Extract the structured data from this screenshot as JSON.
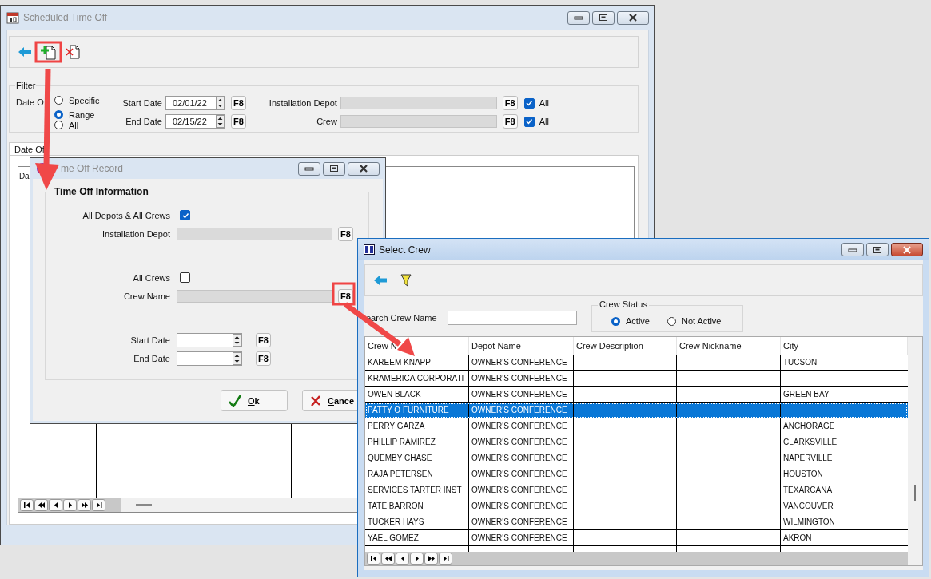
{
  "main_window": {
    "title": "Scheduled Time Off",
    "active": false,
    "filter": {
      "legend": "Filter",
      "date_label": "Date O",
      "radios": [
        {
          "label": "Specific",
          "selected": false
        },
        {
          "label": "Range",
          "selected": true
        },
        {
          "label": "All",
          "selected": false
        }
      ],
      "dates": [
        {
          "label": "Start Date",
          "value": "02/01/22",
          "key": "F8"
        },
        {
          "label": "End Date",
          "value": "02/15/22",
          "key": "F8"
        }
      ],
      "lookups": [
        {
          "label": "Installation Depot",
          "key": "F8",
          "all_label": "All",
          "checked": true
        },
        {
          "label": "Crew",
          "key": "F8",
          "all_label": "All",
          "checked": true
        }
      ]
    },
    "tab": {
      "label": "Date Of",
      "selected": true
    },
    "grid": {
      "column_1": "Da"
    }
  },
  "time_off_record": {
    "title": "me Off Record",
    "active": false,
    "group": "Time Off Information",
    "rows": [
      {
        "kind": "checkbox",
        "label": "All Depots & All Crews",
        "checked": true
      },
      {
        "kind": "lookup",
        "label": "Installation Depot",
        "key": "F8"
      },
      {
        "kind": "checkbox",
        "label": "All Crews",
        "checked": false
      },
      {
        "kind": "lookup",
        "label": "Crew Name",
        "key": "F8"
      },
      {
        "kind": "date",
        "label": "Start Date",
        "key": "F8"
      },
      {
        "kind": "date",
        "label": "End Date",
        "key": "F8"
      }
    ],
    "buttons": [
      {
        "label": "Ok",
        "kind": "ok"
      },
      {
        "label": "Cance",
        "kind": "cancel"
      }
    ]
  },
  "select_crew": {
    "title": "Select Crew",
    "active": true,
    "search": {
      "label": "earch Crew Name"
    },
    "status": {
      "legend": "Crew Status",
      "options": [
        {
          "label": "Active",
          "selected": true
        },
        {
          "label": "Not Active",
          "selected": false
        }
      ]
    },
    "table": {
      "columns": [
        "Crew N",
        "Depot Name",
        "Crew Description",
        "Crew Nickname",
        "City"
      ],
      "rows": [
        {
          "crew_name": "KAREEM KNAPP",
          "depot_name": "OWNER'S CONFERENCE",
          "city": "TUCSON",
          "selected": false
        },
        {
          "crew_name": "KRAMERICA CORPORATI",
          "depot_name": "OWNER'S CONFERENCE",
          "selected": false
        },
        {
          "crew_name": "OWEN BLACK",
          "depot_name": "OWNER'S CONFERENCE",
          "city": "GREEN BAY",
          "selected": false
        },
        {
          "crew_name": "PATTY  O FURNITURE",
          "depot_name": "OWNER'S CONFERENCE",
          "selected": true
        },
        {
          "crew_name": "PERRY GARZA",
          "depot_name": "OWNER'S CONFERENCE",
          "city": "ANCHORAGE",
          "selected": false
        },
        {
          "crew_name": "PHILLIP RAMIREZ",
          "depot_name": "OWNER'S CONFERENCE",
          "city": "CLARKSVILLE",
          "selected": false
        },
        {
          "crew_name": "QUEMBY CHASE",
          "depot_name": "OWNER'S CONFERENCE",
          "city": "NAPERVILLE",
          "selected": false
        },
        {
          "crew_name": "RAJA PETERSEN",
          "depot_name": "OWNER'S CONFERENCE",
          "city": "HOUSTON",
          "selected": false
        },
        {
          "crew_name": "SERVICES TARTER INST",
          "depot_name": "OWNER'S CONFERENCE",
          "city": "TEXARCANA",
          "selected": false
        },
        {
          "crew_name": "TATE BARRON",
          "depot_name": "OWNER'S CONFERENCE",
          "city": "VANCOUVER",
          "selected": false
        },
        {
          "crew_name": "TUCKER HAYS",
          "depot_name": "OWNER'S CONFERENCE",
          "city": "WILMINGTON",
          "selected": false
        },
        {
          "crew_name": "YAEL GOMEZ",
          "depot_name": "OWNER'S CONFERENCE",
          "city": "AKRON",
          "selected": false
        }
      ]
    }
  }
}
